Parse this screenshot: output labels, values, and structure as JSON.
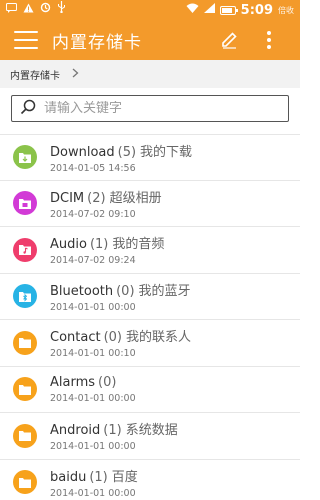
{
  "status_bar": {
    "icons": [
      "message-icon",
      "warning-icon",
      "sync-icon",
      "usb-icon"
    ],
    "time": "5:09",
    "extra": "倍收",
    "battery_level": 0.7
  },
  "app_bar": {
    "title": "内置存储卡",
    "actions": [
      "edit-icon",
      "more-icon"
    ]
  },
  "breadcrumb": {
    "path": "内置存储卡"
  },
  "search": {
    "placeholder": "请输入关键字",
    "value": ""
  },
  "colors": {
    "accent": "#f39a2b",
    "download": "#8bc34a",
    "dcim": "#d23ad6",
    "audio": "#ef3d6c",
    "bluetooth": "#27b3e5",
    "default": "#f7a21b"
  },
  "folders": [
    {
      "name": "Download",
      "count": "(5)",
      "alias": "我的下载",
      "date": "2014-01-05 14:56",
      "icon": "download-icon",
      "color": "#8bc34a"
    },
    {
      "name": "DCIM",
      "count": "(2)",
      "alias": "超级相册",
      "date": "2014-07-02 09:10",
      "icon": "camera-icon",
      "color": "#d23ad6"
    },
    {
      "name": "Audio",
      "count": "(1)",
      "alias": "我的音频",
      "date": "2014-07-02 09:24",
      "icon": "music-icon",
      "color": "#ef3d6c"
    },
    {
      "name": "Bluetooth",
      "count": "(0)",
      "alias": "我的蓝牙",
      "date": "2014-01-01 00:00",
      "icon": "bluetooth-icon",
      "color": "#27b3e5"
    },
    {
      "name": "Contact",
      "count": "(0)",
      "alias": "我的联系人",
      "date": "2014-01-01 00:10",
      "icon": "folder-icon",
      "color": "#f7a21b"
    },
    {
      "name": "Alarms",
      "count": "(0)",
      "alias": "",
      "date": "2014-01-01 00:00",
      "icon": "folder-icon",
      "color": "#f7a21b"
    },
    {
      "name": "Android",
      "count": "(1)",
      "alias": "系统数据",
      "date": "2014-01-01 00:00",
      "icon": "folder-icon",
      "color": "#f7a21b"
    },
    {
      "name": "baidu",
      "count": "(1)",
      "alias": "百度",
      "date": "2014-01-01 00:00",
      "icon": "folder-icon",
      "color": "#f7a21b"
    }
  ]
}
